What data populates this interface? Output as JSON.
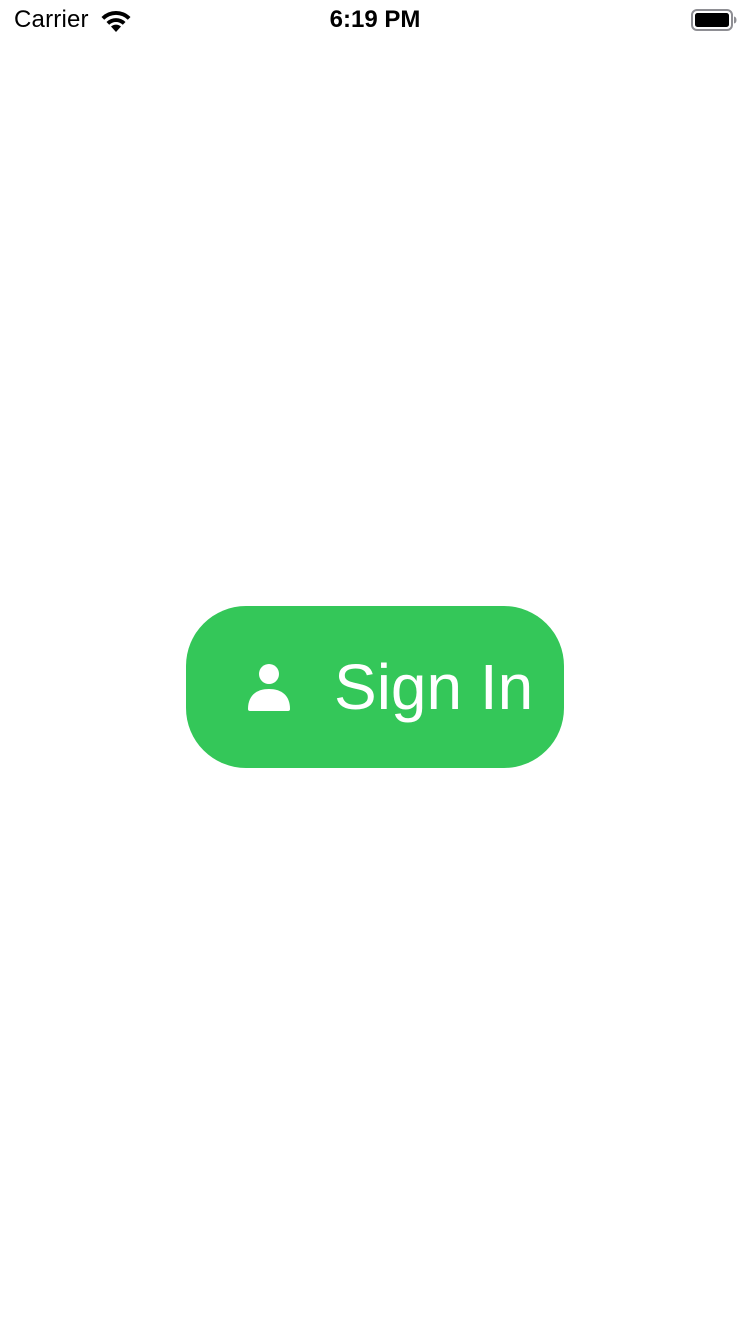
{
  "status_bar": {
    "carrier": "Carrier",
    "time": "6:19 PM",
    "wifi_icon": "wifi-icon",
    "battery_icon": "battery-icon"
  },
  "main": {
    "sign_in_button": {
      "label": "Sign In",
      "icon": "person-icon",
      "background_color": "#34C759",
      "text_color": "#FFFFFF"
    }
  }
}
